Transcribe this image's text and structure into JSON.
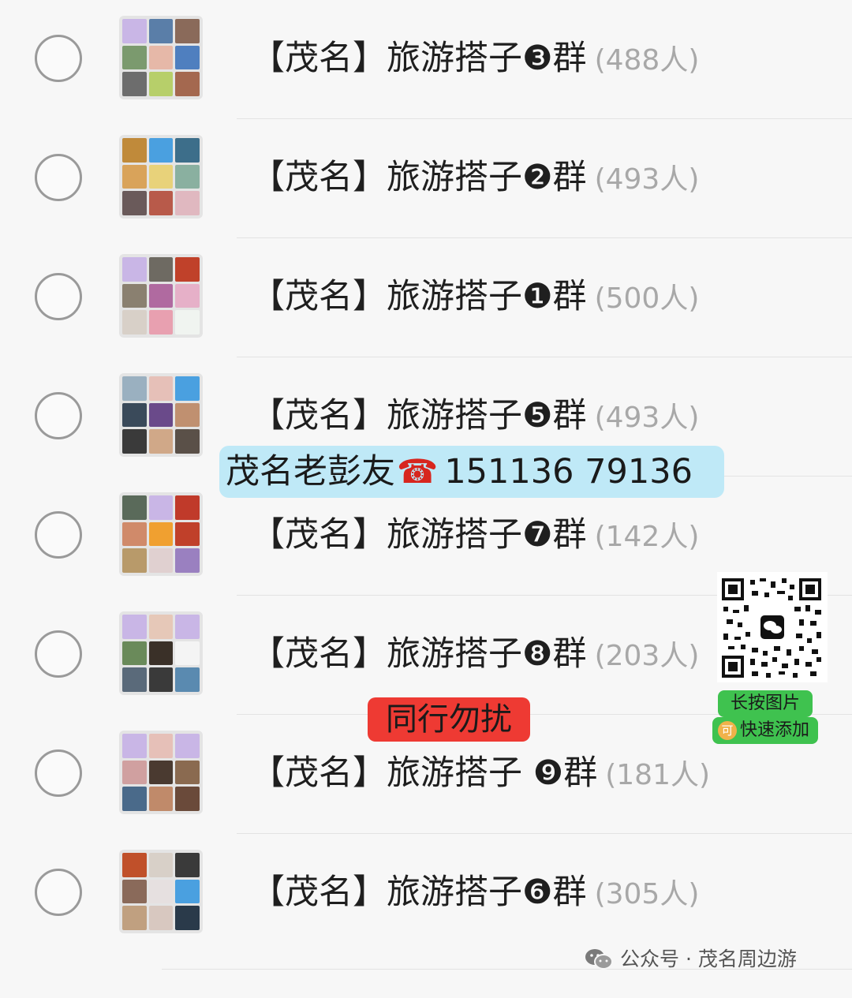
{
  "groups": [
    {
      "name": "【茂名】旅游搭子❸群",
      "count": "(488人)"
    },
    {
      "name": "【茂名】旅游搭子❷群",
      "count": "(493人)"
    },
    {
      "name": "【茂名】旅游搭子❶群",
      "count": "(500人)"
    },
    {
      "name": "【茂名】旅游搭子❺群",
      "count": "(493人)"
    },
    {
      "name": "【茂名】旅游搭子❼群",
      "count": "(142人)"
    },
    {
      "name": "【茂名】旅游搭子❽群",
      "count": "(203人)"
    },
    {
      "name": "【茂名】旅游搭子 ❾群",
      "count": "(181人)"
    },
    {
      "name": "【茂名】旅游搭子❻群",
      "count": "(305人)"
    }
  ],
  "overlay": {
    "contact_name": "茂名老彭友",
    "phone_icon": "telephone-icon",
    "phone": "151136  79136",
    "warning": "同行勿扰",
    "qr": {
      "icon": "wechat-icon",
      "line1": "长按图片",
      "badge": "可",
      "line2": "快速添加"
    }
  },
  "watermark": {
    "icon": "wechat-official-account-icon",
    "text": "公众号 · 茂名周边游"
  },
  "colors": {
    "contact_bg": "#bfe9f7",
    "warning_bg": "#ee3a33",
    "qr_pill_bg": "#3fc24f",
    "count_text": "#a8a8a8"
  }
}
